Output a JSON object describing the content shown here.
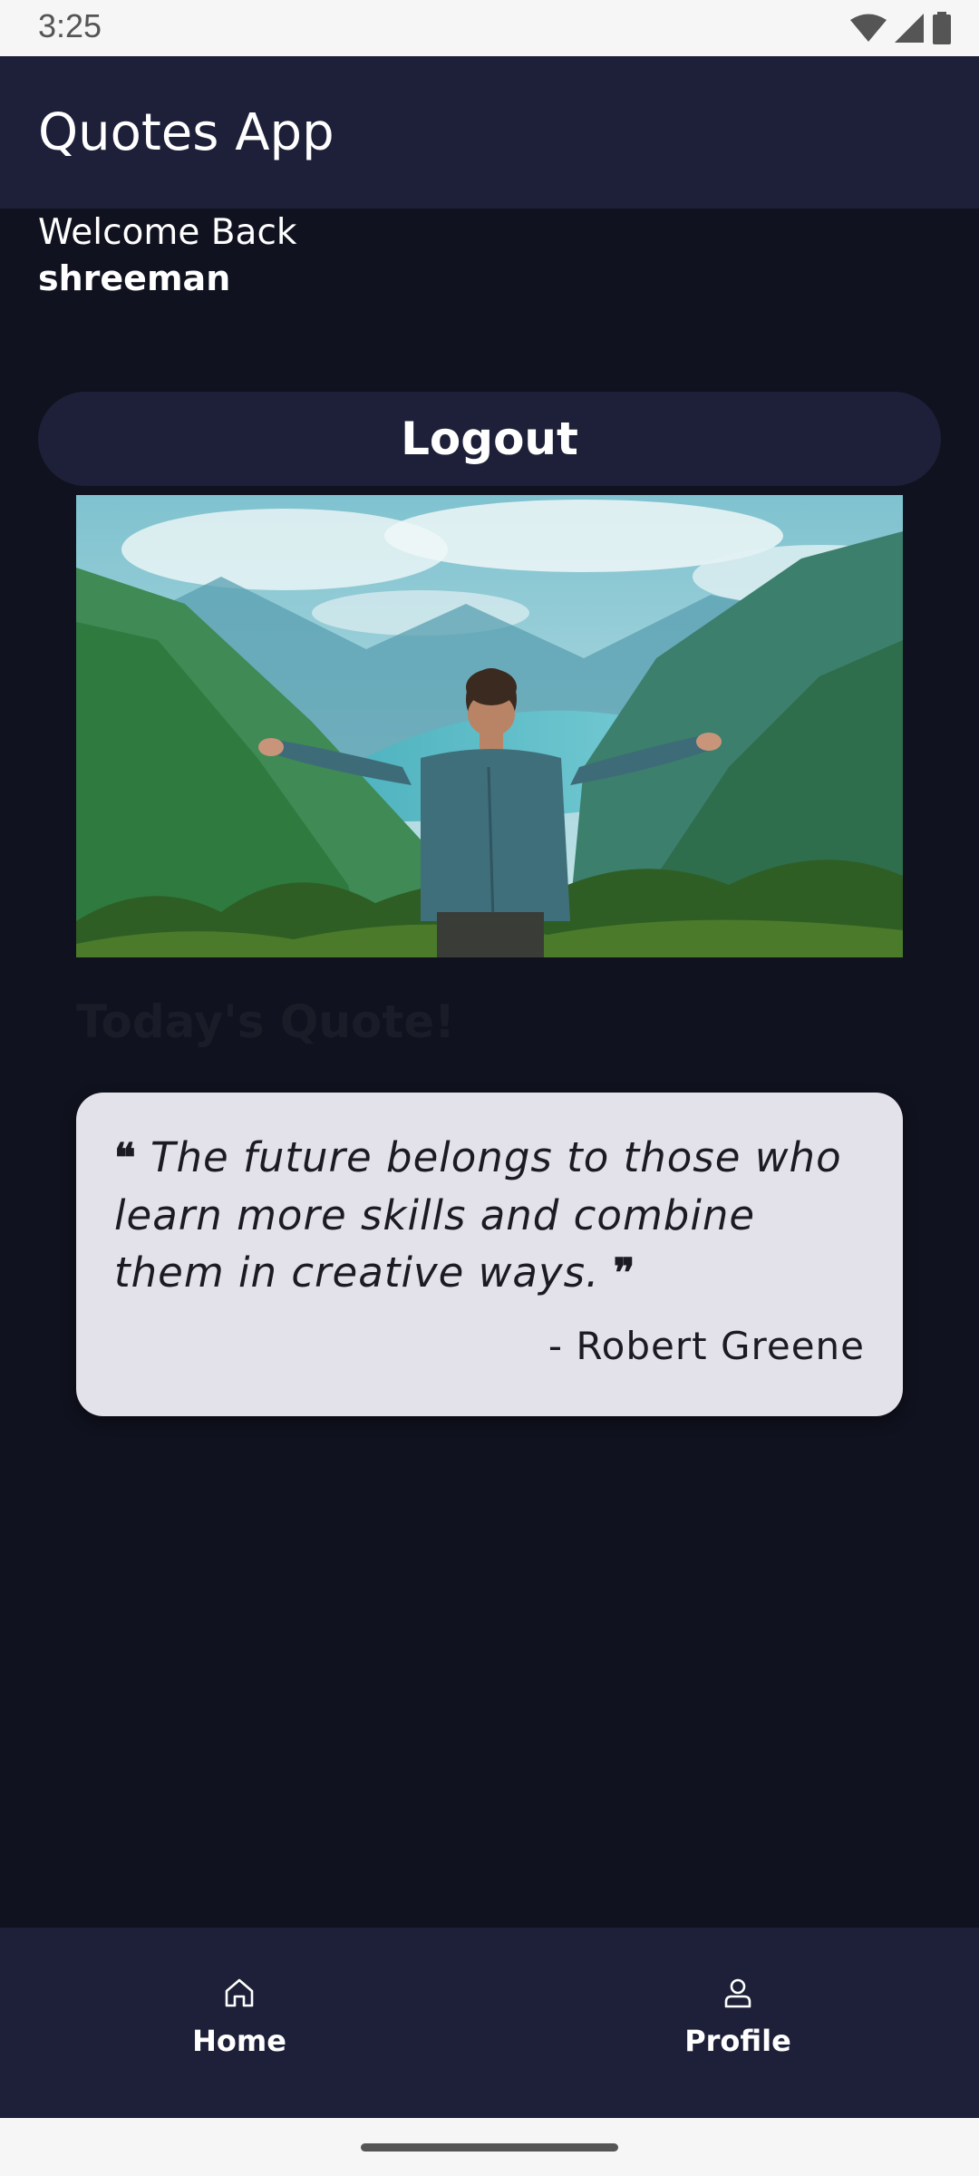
{
  "status_bar": {
    "time": "3:25",
    "icons": [
      "wifi-icon",
      "cell-signal-icon",
      "battery-icon"
    ]
  },
  "app_bar": {
    "title": "Quotes App"
  },
  "greeting": {
    "welcome": "Welcome Back",
    "username": "shreeman"
  },
  "logout": {
    "label": "Logout"
  },
  "hero_image": {
    "subject": "person with outstretched arms facing a mountain valley and lake"
  },
  "section": {
    "title": "Today's Quote!"
  },
  "quote": {
    "open_mark": "❝",
    "text": "The future belongs to those who learn more skills and combine them in creative ways.",
    "close_mark": "❞",
    "author": "- Robert Greene"
  },
  "bottom_nav": {
    "items": [
      {
        "label": "Home",
        "icon": "home-icon"
      },
      {
        "label": "Profile",
        "icon": "profile-icon"
      }
    ]
  },
  "colors": {
    "background": "#10121f",
    "surface": "#1d2038",
    "card": "#e3e1e9",
    "text_on_dark": "#ffffff",
    "text_on_card": "#1c1b23"
  }
}
